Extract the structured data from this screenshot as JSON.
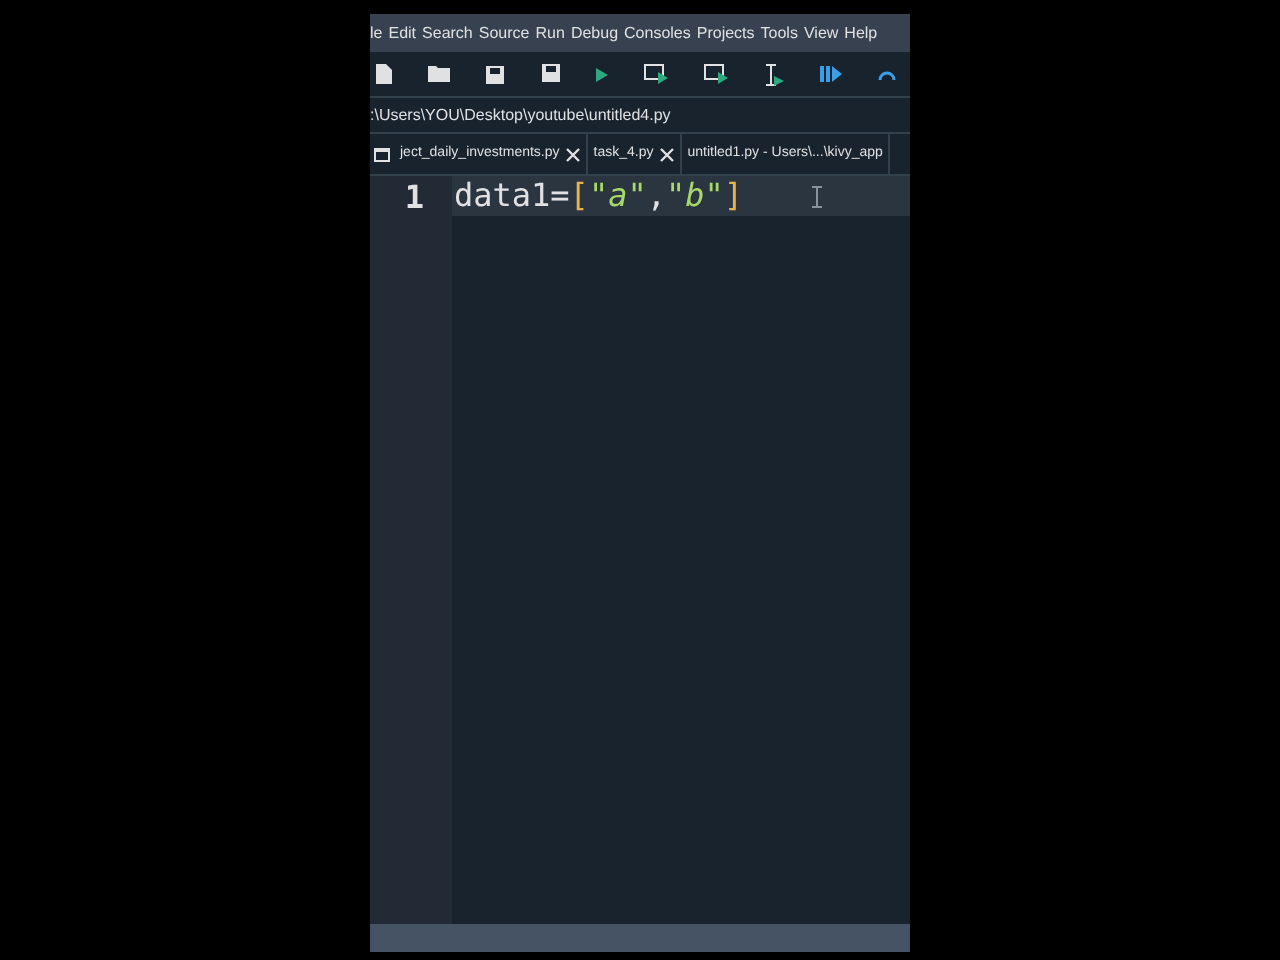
{
  "menu": [
    "le",
    "Edit",
    "Search",
    "Source",
    "Run",
    "Debug",
    "Consoles",
    "Projects",
    "Tools",
    "View",
    "Help"
  ],
  "path_bar": {
    "path": ":\\Users\\YOU\\Desktop\\youtube\\untitled4.py"
  },
  "tabs": [
    {
      "label": "ject_daily_investments.py",
      "closable": true,
      "selected": false
    },
    {
      "label": "task_4.py",
      "closable": true,
      "selected": false
    },
    {
      "label": "untitled1.py - Users\\...\\kivy_app",
      "closable": false,
      "selected": false
    }
  ],
  "editor": {
    "lines": [
      {
        "number": "1",
        "tokens": [
          {
            "kind": "plain",
            "text": "data1="
          },
          {
            "kind": "bracket",
            "text": "["
          },
          {
            "kind": "string",
            "text": "\"a\""
          },
          {
            "kind": "plain",
            "text": ","
          },
          {
            "kind": "string",
            "text": "\"b\""
          },
          {
            "kind": "bracket",
            "text": "]"
          }
        ]
      }
    ]
  }
}
